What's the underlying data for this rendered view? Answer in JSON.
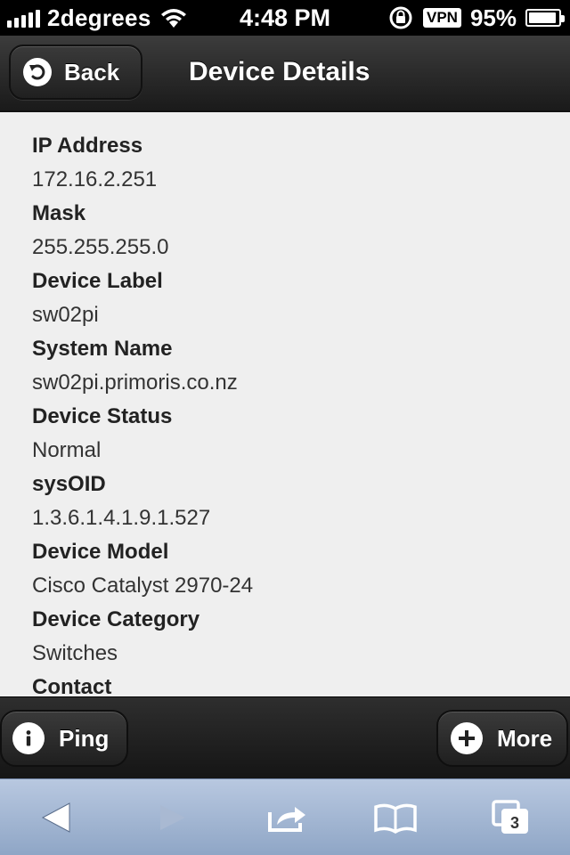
{
  "status_bar": {
    "carrier": "2degrees",
    "time": "4:48 PM",
    "vpn": "VPN",
    "battery": "95%",
    "battery_level": 0.95
  },
  "header": {
    "back_label": "Back",
    "title": "Device Details"
  },
  "details": [
    {
      "label": "IP Address",
      "value": "172.16.2.251"
    },
    {
      "label": "Mask",
      "value": "255.255.255.0"
    },
    {
      "label": "Device Label",
      "value": "sw02pi"
    },
    {
      "label": "System Name",
      "value": "sw02pi.primoris.co.nz"
    },
    {
      "label": "Device Status",
      "value": "Normal"
    },
    {
      "label": "sysOID",
      "value": "1.3.6.1.4.1.9.1.527"
    },
    {
      "label": "Device Model",
      "value": "Cisco Catalyst 2970-24"
    },
    {
      "label": "Device Category",
      "value": "Switches"
    },
    {
      "label": "Contact",
      "value": ""
    }
  ],
  "footer": {
    "ping_label": "Ping",
    "more_label": "More"
  },
  "browser_toolbar": {
    "tab_count": "3"
  }
}
